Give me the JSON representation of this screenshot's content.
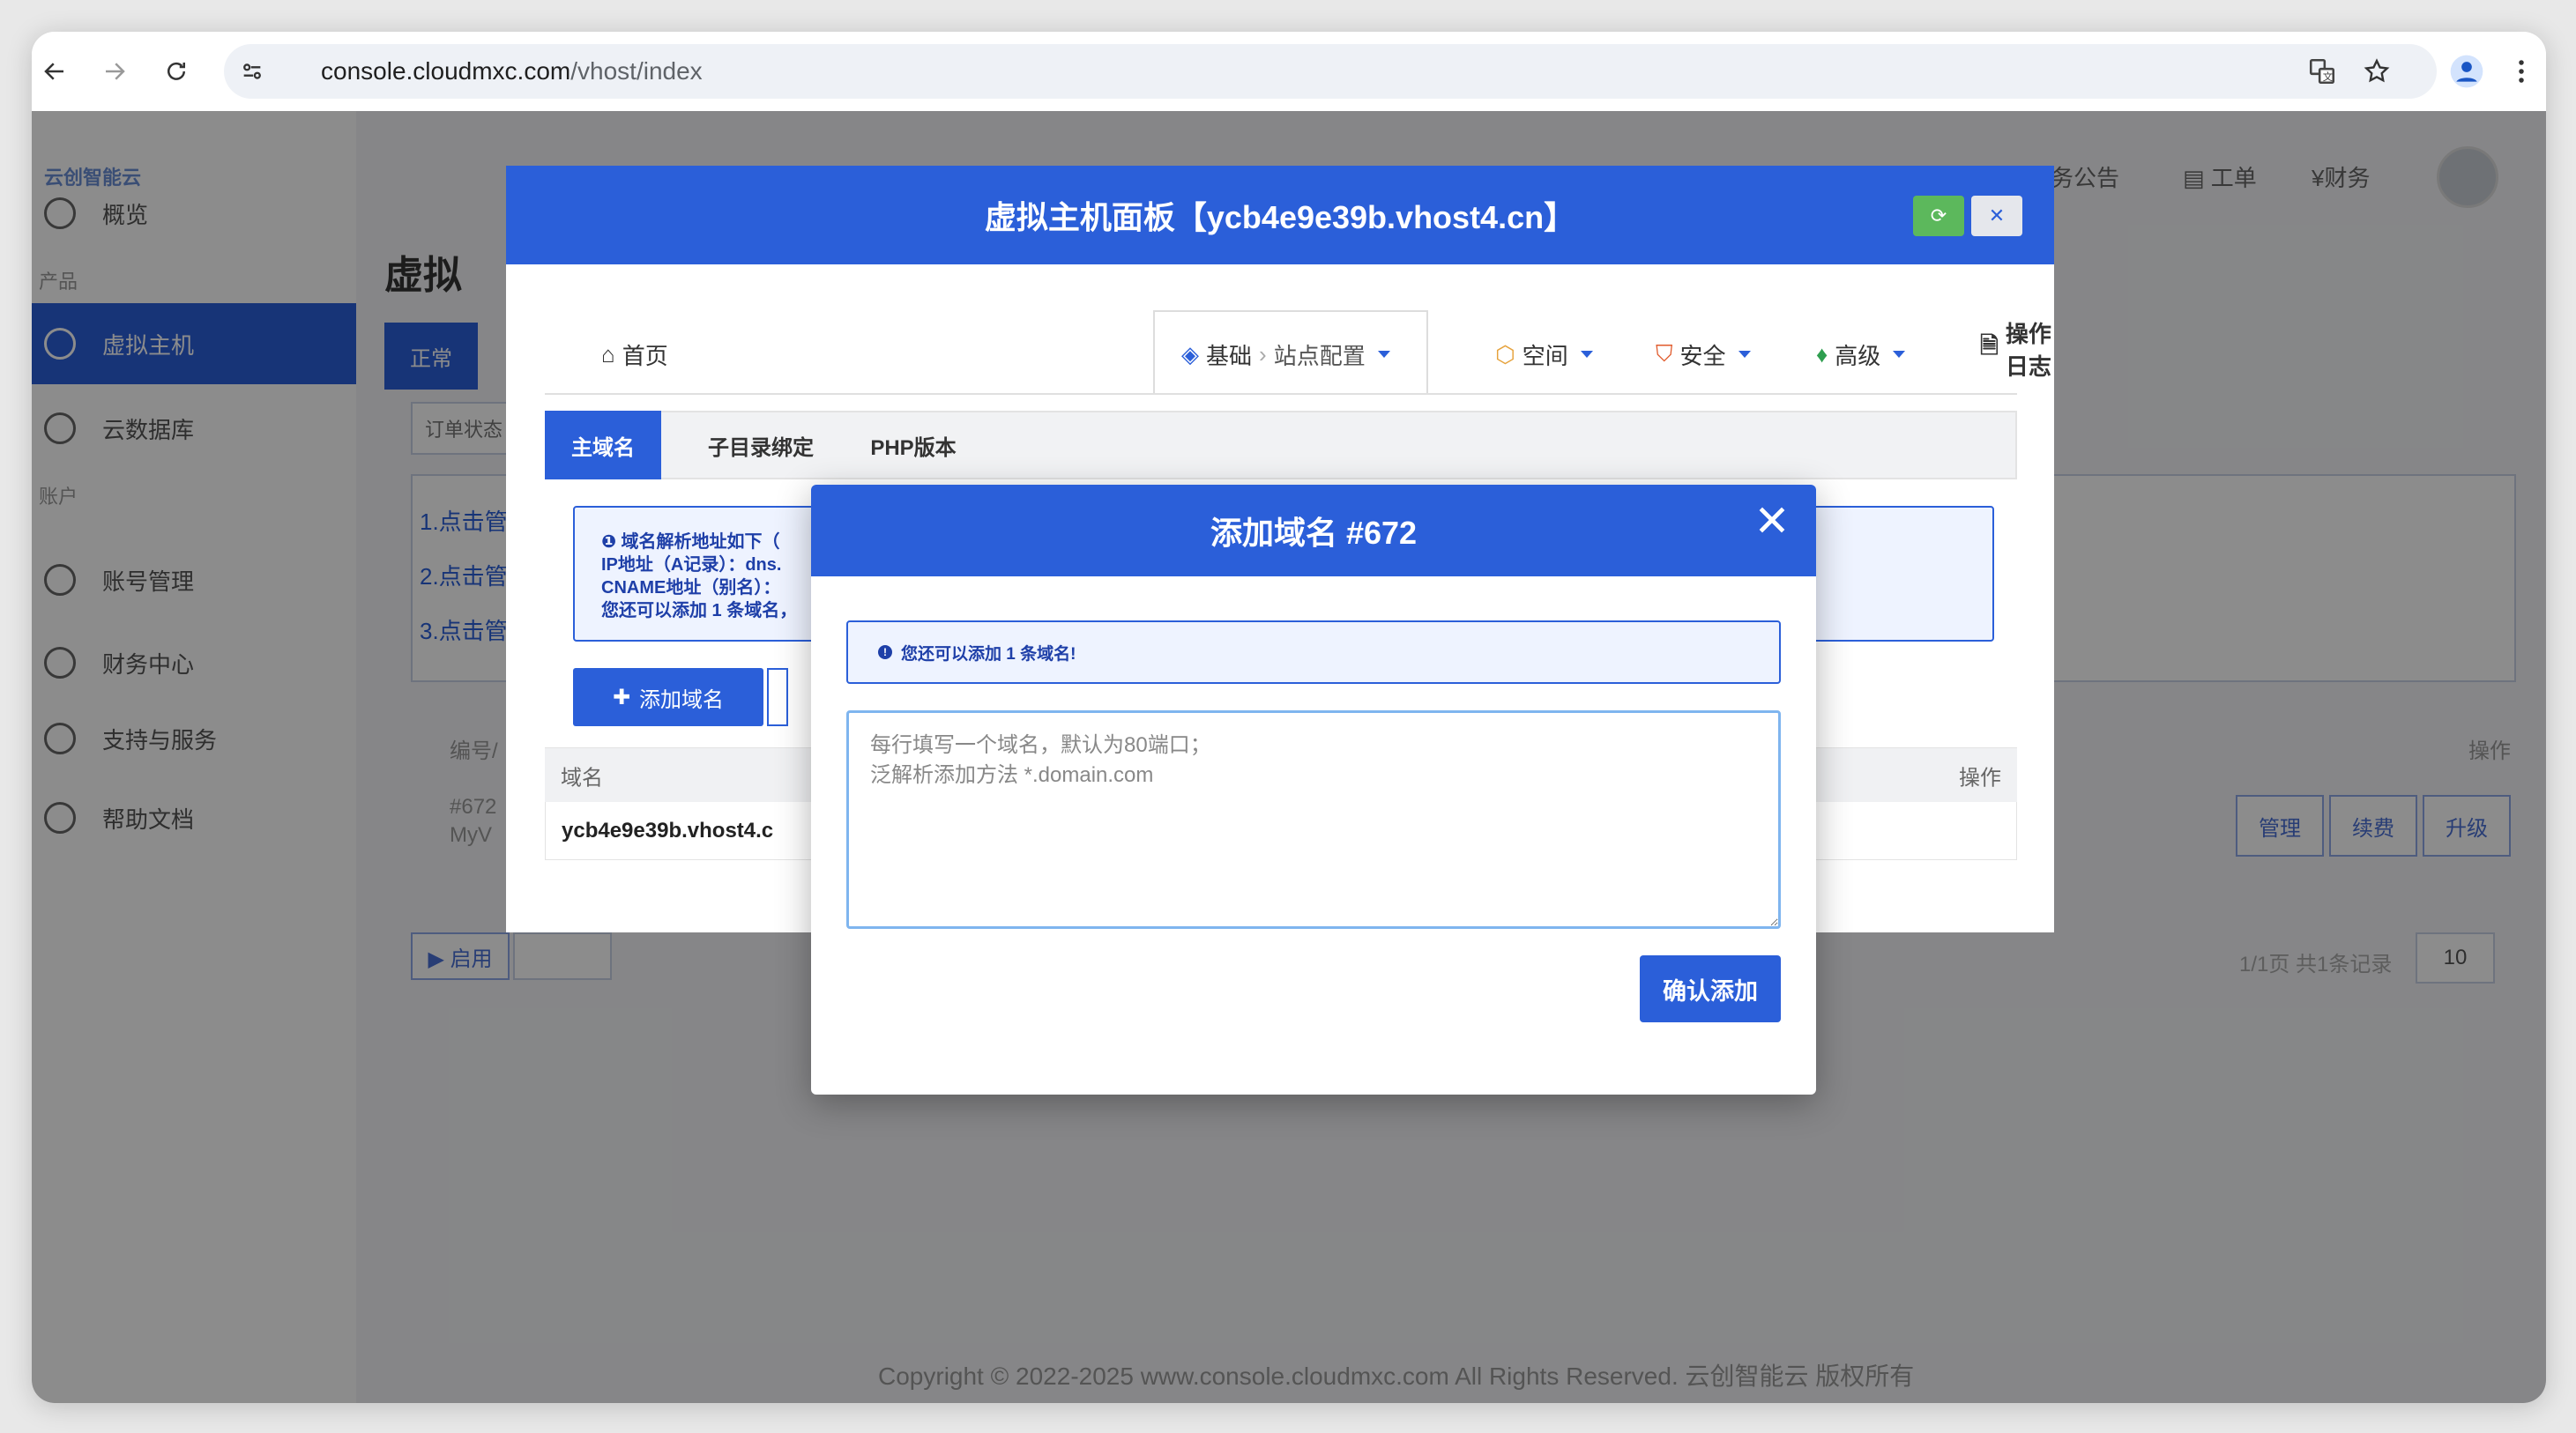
{
  "browser": {
    "url_host": "console.cloudmxc.com",
    "url_path": "/vhost/index"
  },
  "sidebar": {
    "logo": "云创智能云",
    "group_product": "产品",
    "group_account": "账户",
    "items": [
      {
        "label": "概览"
      },
      {
        "label": "虚拟主机"
      },
      {
        "label": "云数据库"
      },
      {
        "label": "账号管理"
      },
      {
        "label": "财务中心"
      },
      {
        "label": "支持与服务"
      },
      {
        "label": "帮助文档"
      }
    ]
  },
  "header": {
    "notice": "务公告",
    "ticket": "工单",
    "finance": "¥财务"
  },
  "background": {
    "title": "虚拟",
    "status_tab": "正常",
    "order_filter": "订单状态",
    "steps": [
      "1.点击管",
      "2.点击管",
      "3.点击管"
    ],
    "col_id": "编号/",
    "col_op": "操作",
    "row_id": "#672",
    "row_name": "MyV",
    "btn_manage": "管理",
    "btn_renew": "续费",
    "btn_upgrade": "升级",
    "btn_start": "▶ 启用",
    "pager": "1/1页 共1条记录",
    "page_size": "10",
    "copyright": "Copyright © 2022-2025 www.console.cloudmxc.com All Rights Reserved. 云创智能云 版权所有"
  },
  "panel": {
    "title": "虚拟主机面板【ycb4e9e39b.vhost4.cn】",
    "tabs": [
      {
        "label": "首页"
      },
      {
        "label": "基础",
        "sub": "站点配置"
      },
      {
        "label": "空间"
      },
      {
        "label": "安全"
      },
      {
        "label": "高级"
      },
      {
        "label": "操作日志"
      }
    ],
    "subtabs": [
      {
        "label": "主域名"
      },
      {
        "label": "子目录绑定"
      },
      {
        "label": "PHP版本"
      }
    ],
    "info_lines": [
      "❶ 域名解析地址如下（",
      "IP地址（A记录）：dns.",
      "CNAME地址（别名）：",
      "您还可以添加 1 条域名，"
    ],
    "add_domain": "添加域名",
    "col_domain": "域名",
    "col_op": "操作",
    "row_domain": "ycb4e9e39b.vhost4.c"
  },
  "dialog": {
    "title": "添加域名 #672",
    "alert": "您还可以添加 1 条域名!",
    "placeholder": "每行填写一个域名，默认为80端口；\n泛解析添加方法 *.domain.com",
    "confirm": "确认添加"
  },
  "colors": {
    "primary": "#2b5fd9",
    "refresh": "#5cb85c"
  }
}
